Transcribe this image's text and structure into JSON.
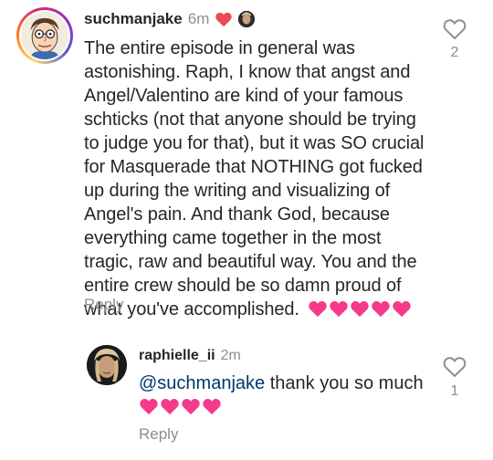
{
  "comment": {
    "username": "suchmanjake",
    "time": "6m",
    "text": "The entire episode in general was astonishing. Raph, I know that angst and Angel/Valentino are kind of your famous schticks (not that anyone should be trying to judge you for that), but it was SO crucial for Masquerade that NOTHING got fucked up during the writing and visualizing of Angel's pain. And thank God, because everything came together in the most tragic, raw and beautiful way. You and the entire crew should be so damn proud of what you've accomplished.",
    "heart_emoji_count": 5,
    "reply_label": "Reply",
    "like_count": "2"
  },
  "reply": {
    "username": "raphielle_ii",
    "time": "2m",
    "mention": "@suchmanjake",
    "text": " thank you so much",
    "heart_emoji_count": 4,
    "reply_label": "Reply",
    "like_count": "1"
  },
  "icons": {
    "like": "heart-outline-icon",
    "author_liked": "red-heart-icon",
    "emoji": "pink-heart-emoji"
  },
  "colors": {
    "text": "#262626",
    "secondary": "#8e8e8e",
    "mention": "#00376b",
    "heart_red": "#ed4956",
    "emoji_pink": "#f5398b"
  }
}
